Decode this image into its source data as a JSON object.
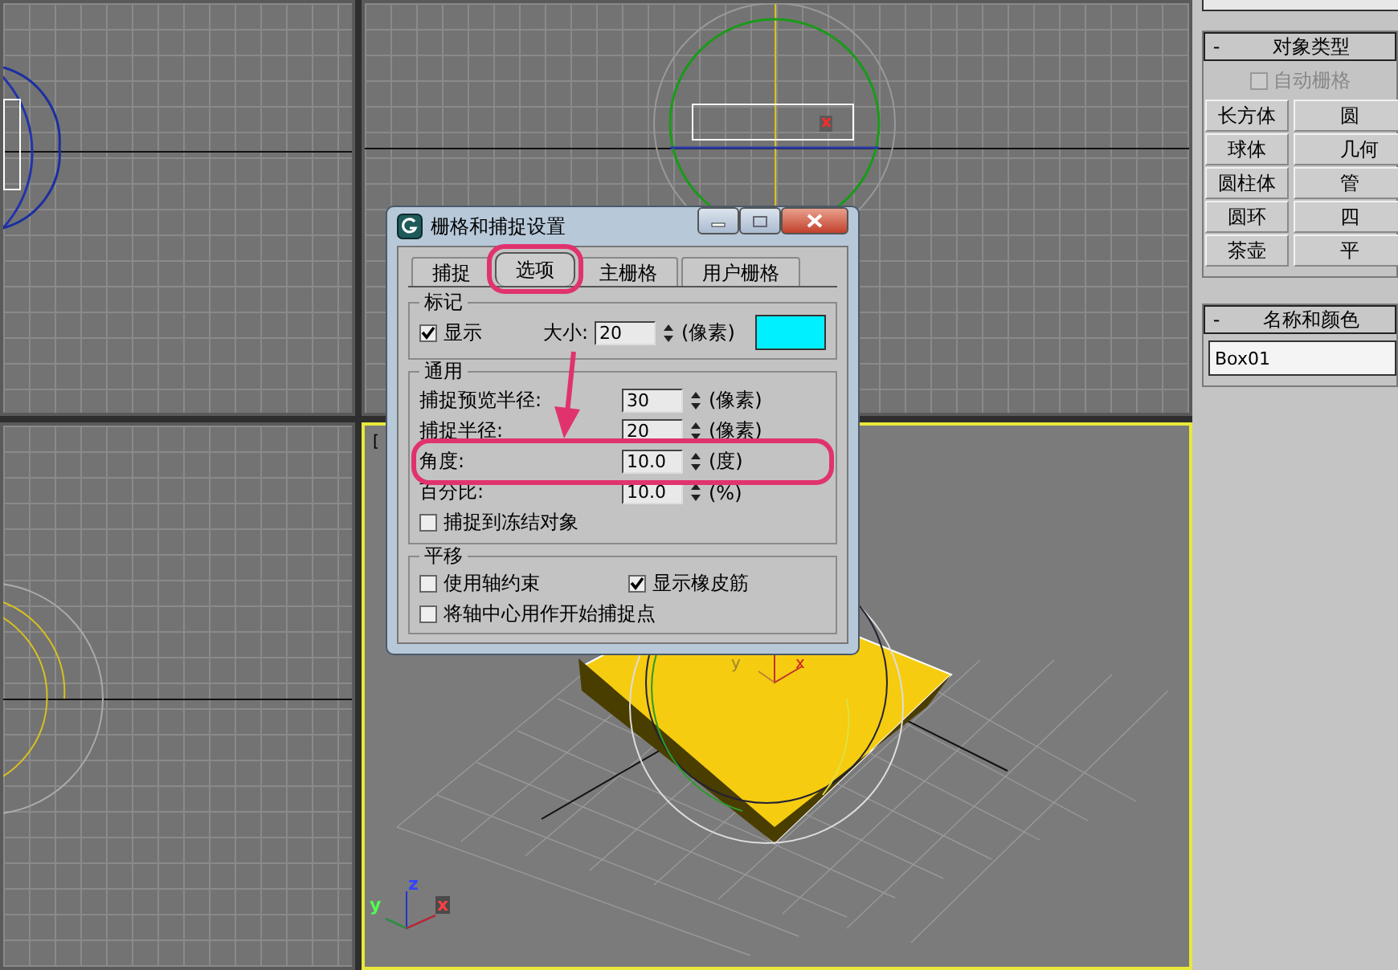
{
  "viewports": [
    {
      "kind": "top",
      "active": false
    },
    {
      "kind": "front",
      "active": false,
      "axis_label": "x"
    },
    {
      "kind": "left",
      "active": false
    },
    {
      "kind": "perspective",
      "active": true,
      "label": "[",
      "gizmo_labels": [
        "y",
        "x"
      ],
      "tripod_labels": [
        "z",
        "y",
        "x"
      ]
    }
  ],
  "command_panel": {
    "object_type": {
      "collapse": "-",
      "title": "对象类型",
      "autogrid": {
        "label": "自动栅格",
        "checked": false,
        "disabled": true
      },
      "buttons": [
        "长方体",
        "圆",
        "球体",
        "几何",
        "圆柱体",
        "管",
        "圆环",
        "四",
        "茶壶",
        "平"
      ]
    },
    "name_and_color": {
      "collapse": "-",
      "title": "名称和颜色",
      "name": "Box01"
    }
  },
  "dialog": {
    "title": "栅格和捕捉设置",
    "tabs": [
      {
        "label": "捕捉",
        "selected": false,
        "highlighted": false
      },
      {
        "label": "选项",
        "selected": true,
        "highlighted": true
      },
      {
        "label": "主栅格",
        "selected": false,
        "highlighted": false
      },
      {
        "label": "用户栅格",
        "selected": false,
        "highlighted": false
      }
    ],
    "marker": {
      "title": "标记",
      "display": {
        "label": "显示",
        "checked": true
      },
      "size_label": "大小:",
      "size": "20",
      "size_unit": "(像素)",
      "color": "#00f0ff"
    },
    "general": {
      "title": "通用",
      "rows": [
        {
          "label": "捕捉预览半径:",
          "value": "30",
          "unit": "(像素)",
          "highlighted": false
        },
        {
          "label": "捕捉半径:",
          "value": "20",
          "unit": "(像素)",
          "highlighted": false
        },
        {
          "label": "角度:",
          "value": "10.0",
          "unit": "(度)",
          "highlighted": true
        },
        {
          "label": "百分比:",
          "value": "10.0",
          "unit": "(%)",
          "highlighted": false
        }
      ],
      "freeze": {
        "label": "捕捉到冻结对象",
        "checked": false
      }
    },
    "translate": {
      "title": "平移",
      "options": [
        {
          "label": "使用轴约束",
          "checked": false
        },
        {
          "label": "显示橡皮筋",
          "checked": true
        },
        {
          "label": "将轴中心用作开始捕捉点",
          "checked": false
        }
      ]
    }
  }
}
